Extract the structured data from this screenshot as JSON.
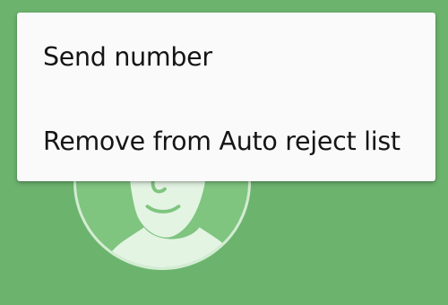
{
  "menu": {
    "items": [
      {
        "label": "Send number"
      },
      {
        "label": "Remove from Auto reject list"
      }
    ]
  },
  "colors": {
    "background": "#6cb46e",
    "avatar_fill": "#7fc47f",
    "avatar_silhouette": "#e3f4e3",
    "menu_background": "#fafafa",
    "menu_text": "#151515"
  },
  "icons": {
    "avatar": "person-silhouette-icon"
  }
}
